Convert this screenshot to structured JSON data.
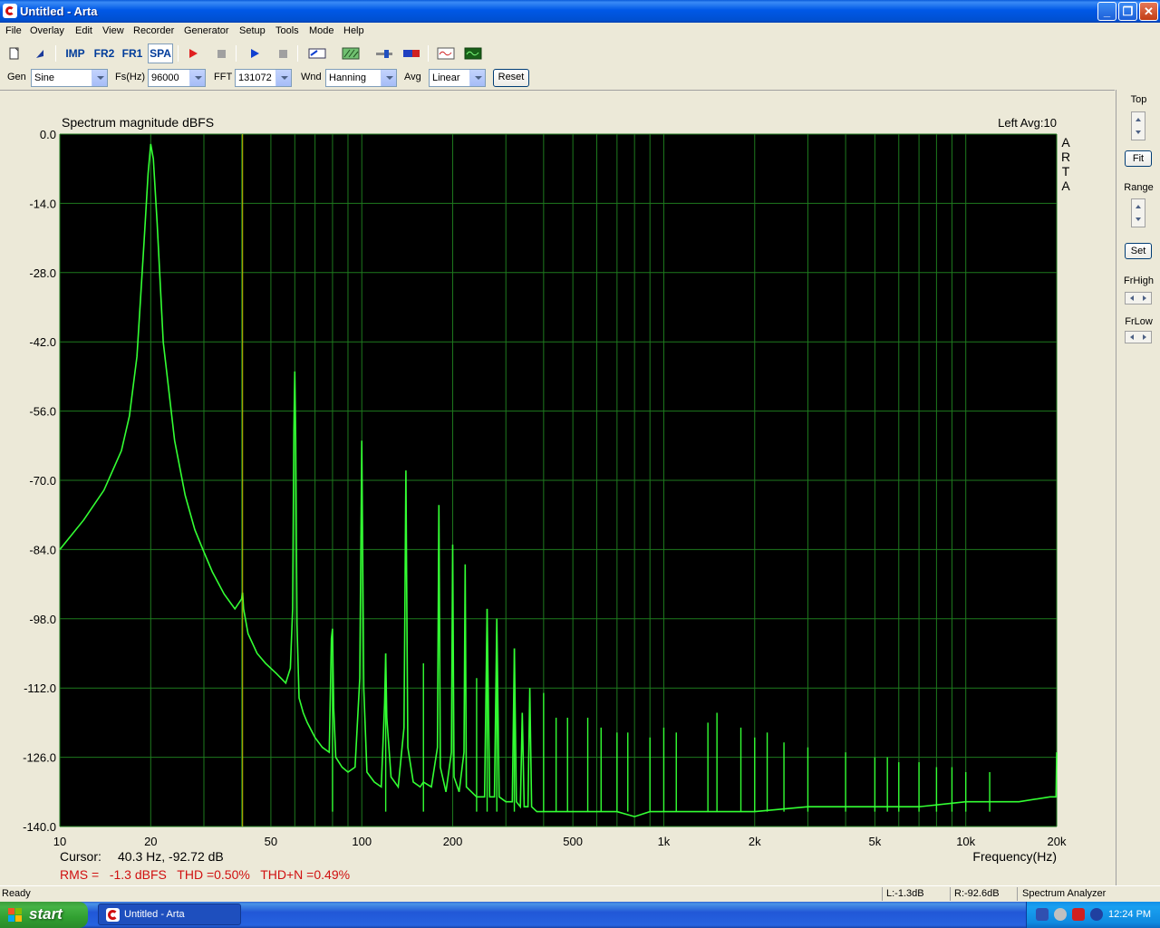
{
  "window": {
    "title": "Untitled - Arta",
    "min_glyph": "_",
    "max_glyph": "❐",
    "close_glyph": "✕"
  },
  "menu": [
    "File",
    "Overlay",
    "Edit",
    "View",
    "Recorder",
    "Generator",
    "Setup",
    "Tools",
    "Mode",
    "Help"
  ],
  "toolbar": {
    "imp": "IMP",
    "fr2": "FR2",
    "fr1": "FR1",
    "spa": "SPA"
  },
  "controls": {
    "gen_label": "Gen",
    "gen_value": "Sine",
    "fs_label": "Fs(Hz)",
    "fs_value": "96000",
    "fft_label": "FFT",
    "fft_value": "131072",
    "wnd_label": "Wnd",
    "wnd_value": "Hanning",
    "avg_label": "Avg",
    "avg_value": "Linear",
    "reset_label": "Reset"
  },
  "right_panel": {
    "top_label": "Top",
    "fit_label": "Fit",
    "range_label": "Range",
    "set_label": "Set",
    "frhigh_label": "FrHigh",
    "frlow_label": "FrLow"
  },
  "graph": {
    "cursor_label": "Cursor:",
    "cursor_value": "40.3 Hz, -92.72 dB",
    "stats": "RMS =   -1.3 dBFS   THD =0.50%   THD+N =0.49%",
    "channel_info": "Left  Avg:10",
    "arta_letters": [
      "A",
      "R",
      "T",
      "A"
    ],
    "cursor_freq": 40.3
  },
  "chart_data": {
    "type": "line",
    "title": "Spectrum magnitude dBFS",
    "xlabel": "Frequency(Hz)",
    "ylabel": "",
    "xscale": "log",
    "xlim": [
      10,
      20000
    ],
    "ylim": [
      -140,
      0
    ],
    "grid": true,
    "yticks": [
      0,
      -14,
      -28,
      -42,
      -56,
      -70,
      -84,
      -98,
      -112,
      -126,
      -140
    ],
    "ytick_labels": [
      "0.0",
      "-14.0",
      "-28.0",
      "-42.0",
      "-56.0",
      "-70.0",
      "-84.0",
      "-98.0",
      "-112.0",
      "-126.0",
      "-140.0"
    ],
    "xticks": [
      10,
      20,
      50,
      100,
      200,
      500,
      1000,
      2000,
      5000,
      10000,
      20000
    ],
    "xtick_labels": [
      "10",
      "20",
      "50",
      "100",
      "200",
      "500",
      "1k",
      "2k",
      "5k",
      "10k",
      "20k"
    ],
    "line_color": "#33FF33",
    "background": "#000000",
    "grid_color": "#1E7A1E",
    "series": [
      {
        "x": [
          10,
          12,
          14,
          16,
          17,
          18,
          19,
          19.6,
          20,
          20.4,
          21,
          22,
          24,
          26,
          28,
          30,
          32,
          35,
          38,
          40,
          40.3,
          40.6,
          42,
          45,
          48,
          52,
          56,
          58,
          59,
          59.6,
          60,
          60.4,
          61,
          62,
          64,
          66,
          70,
          74,
          78,
          79.3,
          80,
          80.7,
          82,
          86,
          90,
          95,
          98.5,
          100,
          101.5,
          104,
          110,
          116,
          119,
          120,
          121,
          125,
          132,
          138,
          140,
          142,
          148,
          156,
          160,
          170,
          178,
          180,
          182,
          190,
          198,
          200,
          202,
          210,
          218,
          220,
          222,
          240,
          255,
          260,
          265,
          275,
          280,
          285,
          300,
          315,
          320,
          325,
          335,
          340,
          345,
          355,
          360,
          365,
          380,
          400,
          420,
          450,
          500,
          550,
          600,
          700,
          800,
          900,
          1000,
          1500,
          2000,
          3000,
          5000,
          7000,
          10000,
          15000,
          19000,
          19900,
          20000
        ],
        "y": [
          -84,
          -78,
          -72,
          -64,
          -57,
          -45,
          -22,
          -8,
          -2,
          -5,
          -18,
          -42,
          -62,
          -73,
          -80,
          -84.5,
          -88.5,
          -93,
          -96,
          -94,
          -92.7,
          -96,
          -101,
          -105,
          -107,
          -109,
          -111,
          -108,
          -96,
          -60,
          -48,
          -62,
          -99,
          -114,
          -117,
          -119,
          -122,
          -124,
          -125,
          -102,
          -100,
          -116,
          -126,
          -128,
          -129,
          -128,
          -110,
          -62,
          -112,
          -129,
          -131,
          -132,
          -115,
          -105,
          -118,
          -130,
          -132,
          -120,
          -68,
          -124,
          -131,
          -132,
          -131,
          -132,
          -124,
          -75,
          -128,
          -133,
          -125,
          -83,
          -130,
          -133,
          -125,
          -87,
          -132,
          -134,
          -134,
          -96,
          -134,
          -134,
          -98,
          -134,
          -135,
          -135,
          -104,
          -135,
          -136,
          -117,
          -136,
          -136,
          -112,
          -136,
          -137,
          -137,
          -137,
          -137,
          -137,
          -137,
          -137,
          -137,
          -138,
          -137,
          -137,
          -137,
          -137,
          -136,
          -136,
          -136,
          -135,
          -135,
          -134,
          -134,
          -125
        ]
      }
    ],
    "harmonic_spurs": [
      {
        "x": 80,
        "y": -102
      },
      {
        "x": 120,
        "y": -105
      },
      {
        "x": 160,
        "y": -107
      },
      {
        "x": 240,
        "y": -110
      },
      {
        "x": 260,
        "y": -96
      },
      {
        "x": 280,
        "y": -98
      },
      {
        "x": 320,
        "y": -104
      },
      {
        "x": 400,
        "y": -113
      },
      {
        "x": 440,
        "y": -118
      },
      {
        "x": 480,
        "y": -118
      },
      {
        "x": 560,
        "y": -118
      },
      {
        "x": 620,
        "y": -120
      },
      {
        "x": 700,
        "y": -121
      },
      {
        "x": 760,
        "y": -121
      },
      {
        "x": 900,
        "y": -122
      },
      {
        "x": 1000,
        "y": -120
      },
      {
        "x": 1100,
        "y": -121
      },
      {
        "x": 1400,
        "y": -119
      },
      {
        "x": 1500,
        "y": -117
      },
      {
        "x": 1800,
        "y": -120
      },
      {
        "x": 2000,
        "y": -122
      },
      {
        "x": 2200,
        "y": -121
      },
      {
        "x": 2500,
        "y": -123
      },
      {
        "x": 3000,
        "y": -124
      },
      {
        "x": 4000,
        "y": -125
      },
      {
        "x": 5000,
        "y": -126
      },
      {
        "x": 5500,
        "y": -126
      },
      {
        "x": 6000,
        "y": -127
      },
      {
        "x": 7000,
        "y": -127
      },
      {
        "x": 8000,
        "y": -128
      },
      {
        "x": 9000,
        "y": -128
      },
      {
        "x": 10000,
        "y": -129
      },
      {
        "x": 12000,
        "y": -129
      }
    ]
  },
  "status": {
    "ready": "Ready",
    "left": "L:-1.3dB",
    "right": "R:-92.6dB",
    "mode": "Spectrum Analyzer"
  },
  "taskbar": {
    "start": "start",
    "task_item": "Untitled - Arta",
    "clock": "12:24 PM"
  }
}
